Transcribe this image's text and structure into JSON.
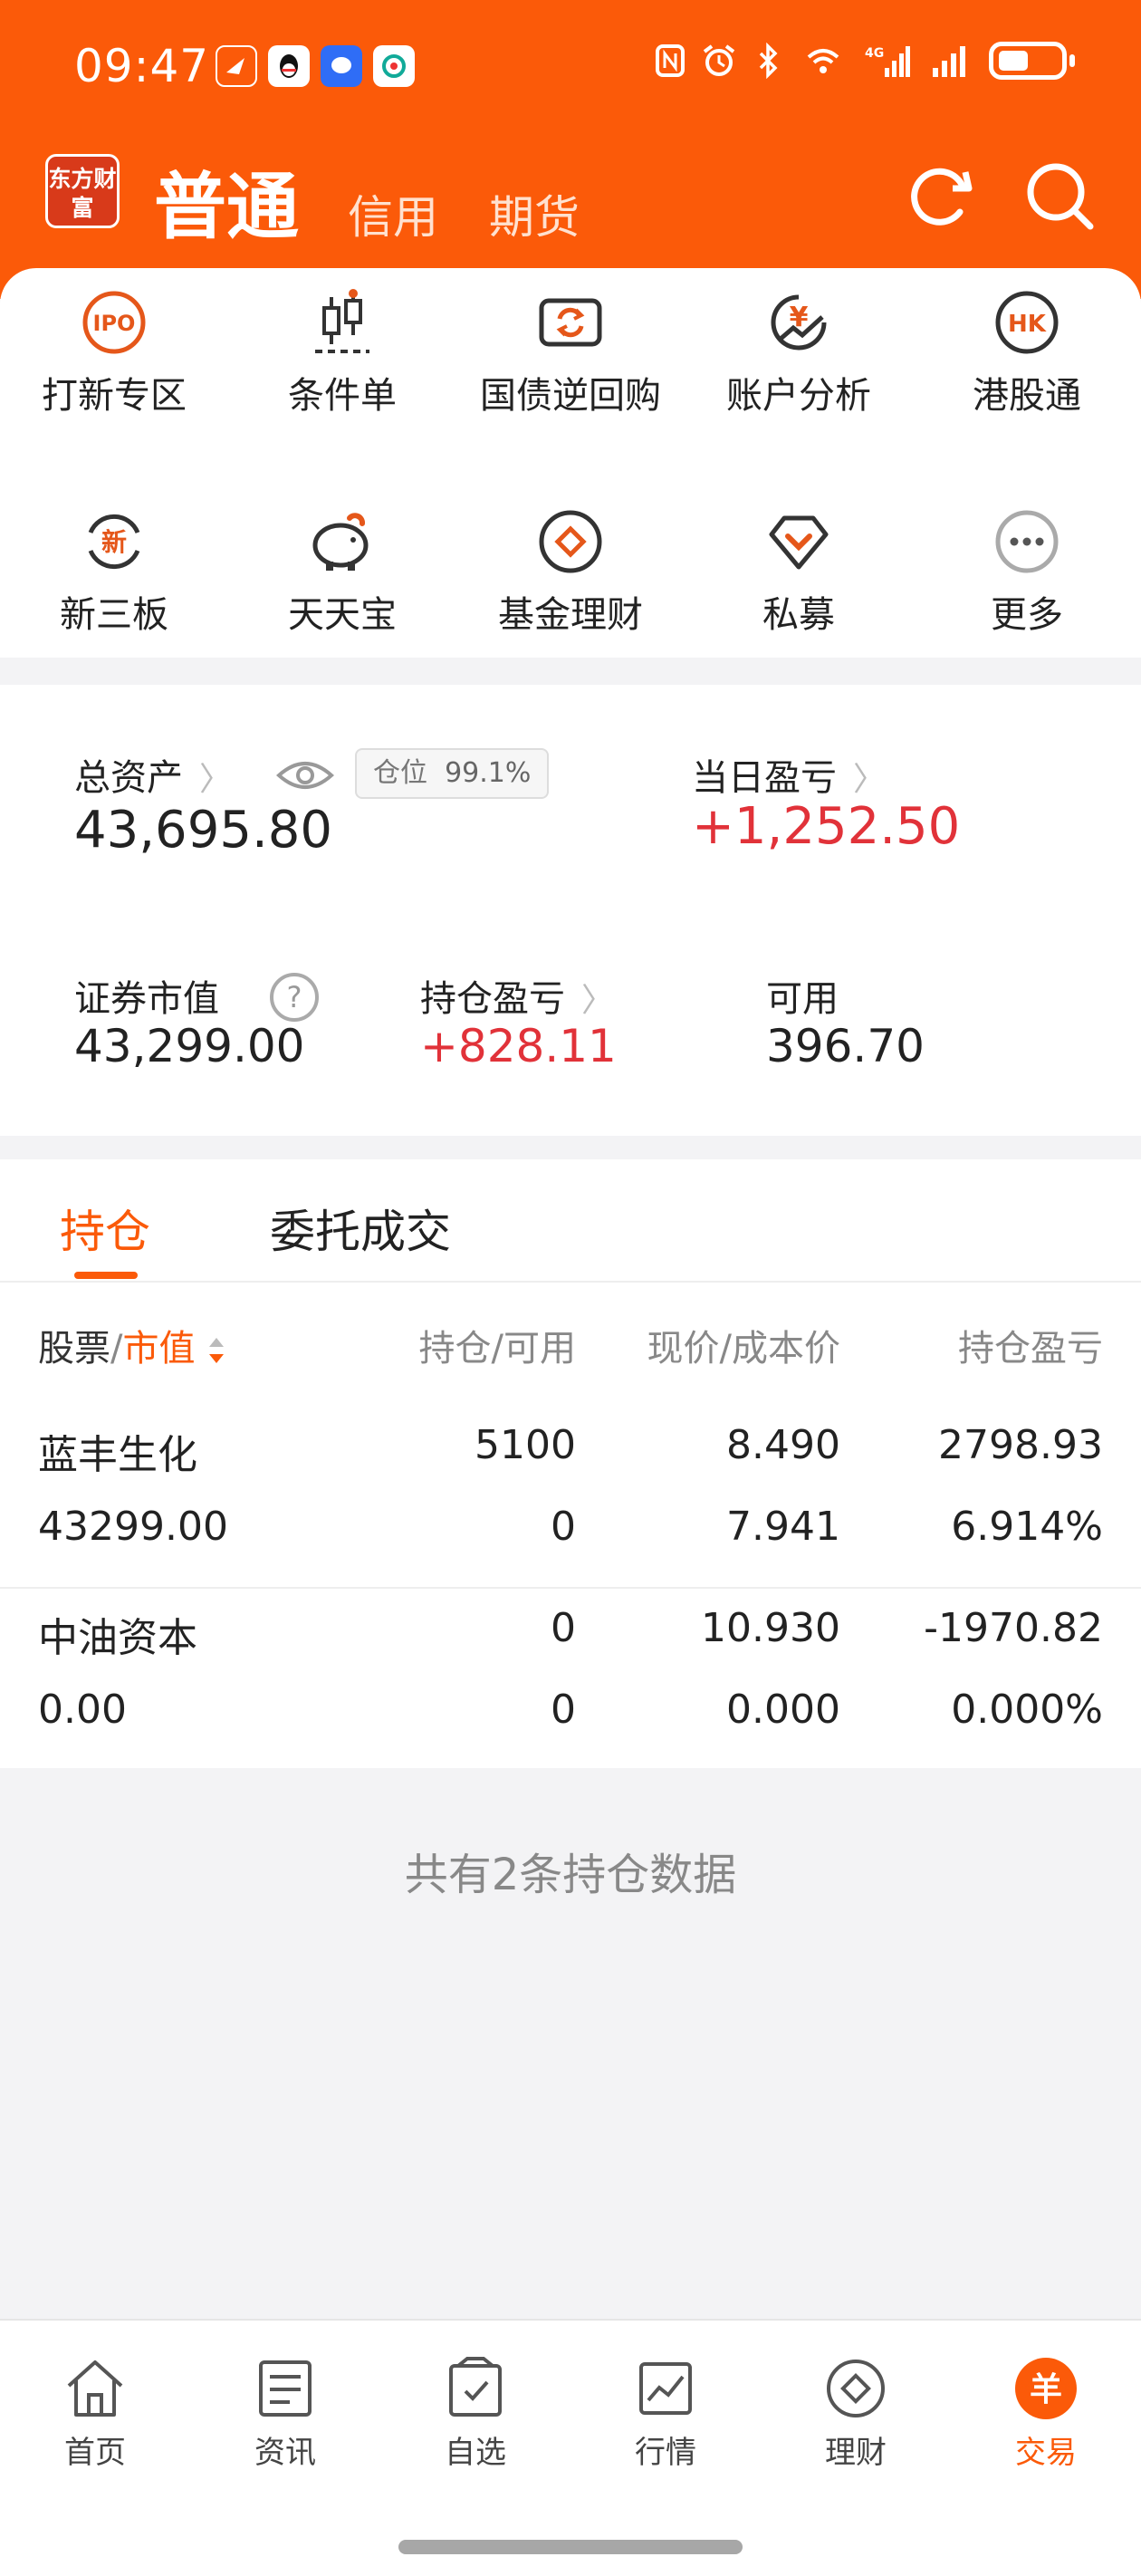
{
  "status_bar": {
    "time": "09:47"
  },
  "header": {
    "logo_text": "东方财富",
    "tabs": [
      {
        "label": "普通",
        "active": true
      },
      {
        "label": "信用",
        "active": false
      },
      {
        "label": "期货",
        "active": false
      }
    ],
    "accent_color": "#fb5a09"
  },
  "quick_menu": [
    {
      "label": "打新专区",
      "icon": "ipo-icon",
      "icon_text": "IPO"
    },
    {
      "label": "条件单",
      "icon": "candlestick-icon"
    },
    {
      "label": "国债逆回购",
      "icon": "repo-icon"
    },
    {
      "label": "账户分析",
      "icon": "yen-chart-icon",
      "icon_text": "¥"
    },
    {
      "label": "港股通",
      "icon": "hk-icon",
      "icon_text": "HK"
    },
    {
      "label": "新三板",
      "icon": "new-board-icon",
      "icon_text": "新"
    },
    {
      "label": "天天宝",
      "icon": "piggy-bank-icon"
    },
    {
      "label": "基金理财",
      "icon": "fund-icon"
    },
    {
      "label": "私募",
      "icon": "private-fund-icon"
    },
    {
      "label": "更多",
      "icon": "more-icon"
    }
  ],
  "assets": {
    "total_label": "总资产",
    "total_value": "43,695.80",
    "position_label": "仓位",
    "position_value": "99.1%",
    "daily_pl_label": "当日盈亏",
    "daily_pl_value": "+1,252.50",
    "market_value_label": "证券市值",
    "market_value": "43,299.00",
    "holding_pl_label": "持仓盈亏",
    "holding_pl_value": "+828.11",
    "available_label": "可用",
    "available_value": "396.70"
  },
  "holdings": {
    "tabs": [
      "持仓",
      "委托成交"
    ],
    "headers": {
      "stock": "股票",
      "sep": "/",
      "market_value": "市值",
      "qty": "持仓/可用",
      "price": "现价/成本价",
      "pl": "持仓盈亏"
    },
    "rows": [
      {
        "name": "蓝丰生化",
        "market_value": "43299.00",
        "position": "5100",
        "available": "0",
        "price": "8.490",
        "cost": "7.941",
        "pl": "2798.93",
        "pl_pct": "6.914%",
        "trend": "up"
      },
      {
        "name": "中油资本",
        "market_value": "0.00",
        "position": "0",
        "available": "0",
        "price": "10.930",
        "cost": "0.000",
        "pl": "-1970.82",
        "pl_pct": "0.000%",
        "trend": "down"
      }
    ],
    "summary": "共有2条持仓数据"
  },
  "bottom_nav": [
    {
      "label": "首页",
      "icon": "home-icon"
    },
    {
      "label": "资讯",
      "icon": "news-icon"
    },
    {
      "label": "自选",
      "icon": "watchlist-icon"
    },
    {
      "label": "行情",
      "icon": "market-icon"
    },
    {
      "label": "理财",
      "icon": "wealth-icon"
    },
    {
      "label": "交易",
      "icon": "trade-icon",
      "icon_text": "羊",
      "active": true
    }
  ]
}
